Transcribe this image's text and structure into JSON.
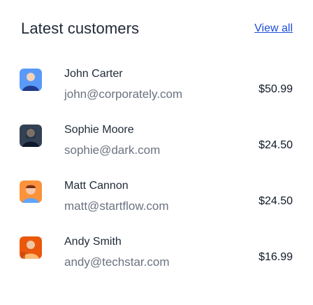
{
  "header": {
    "title": "Latest customers",
    "view_all_label": "View all"
  },
  "customers": [
    {
      "name": "John Carter",
      "email": "john@corporately.com",
      "amount": "$50.99",
      "avatar_color": "#3b82f6",
      "avatar_icon": "person-avatar-icon"
    },
    {
      "name": "Sophie Moore",
      "email": "sophie@dark.com",
      "amount": "$24.50",
      "avatar_color": "#334155",
      "avatar_icon": "person-avatar-icon"
    },
    {
      "name": "Matt Cannon",
      "email": "matt@startflow.com",
      "amount": "$24.50",
      "avatar_color": "#f97316",
      "avatar_icon": "person-avatar-icon"
    },
    {
      "name": "Andy Smith",
      "email": "andy@techstar.com",
      "amount": "$16.99",
      "avatar_color": "#ea580c",
      "avatar_icon": "person-avatar-icon"
    }
  ]
}
